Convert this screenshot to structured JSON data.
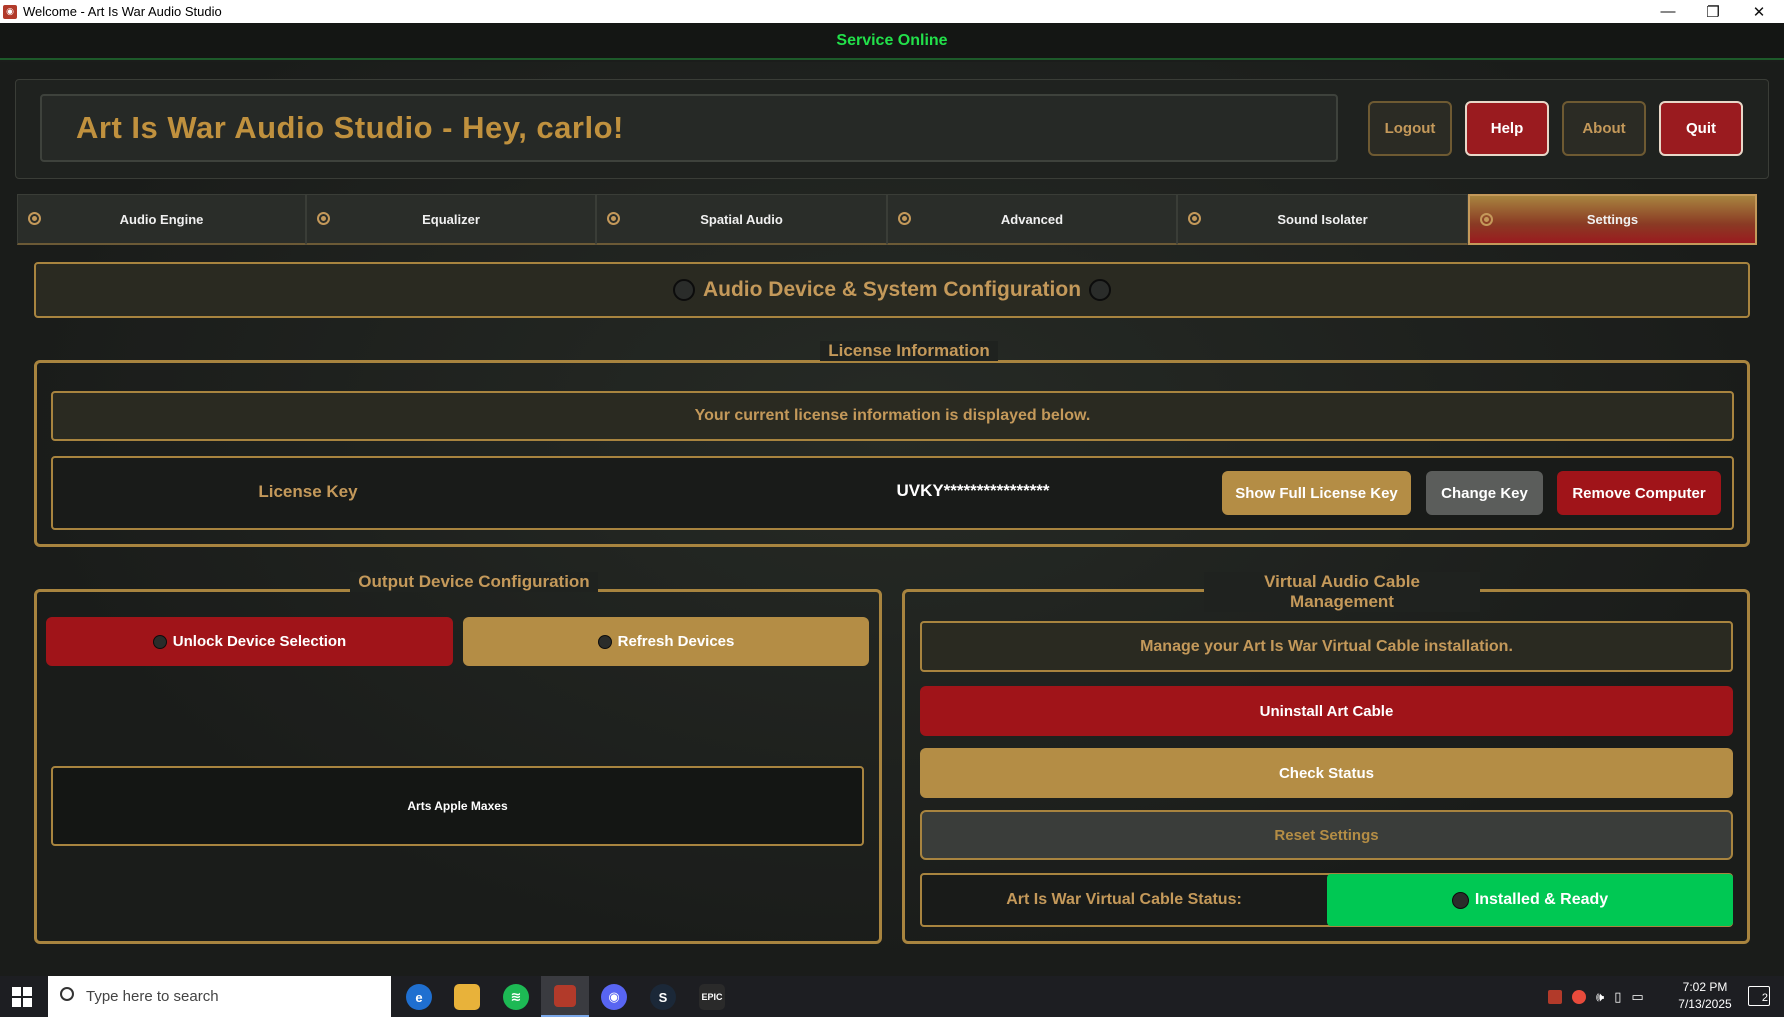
{
  "window": {
    "title": "Welcome - Art Is War Audio Studio",
    "minimize_glyph": "—",
    "restore_glyph": "❐",
    "close_glyph": "✕"
  },
  "service_status": "Service Online",
  "header": {
    "title": "Art Is War Audio Studio - Hey, carlo!",
    "buttons": {
      "logout": "Logout",
      "help": "Help",
      "about": "About",
      "quit": "Quit"
    }
  },
  "tabs": [
    {
      "label": "Audio Engine",
      "active": false
    },
    {
      "label": "Equalizer",
      "active": false
    },
    {
      "label": "Spatial Audio",
      "active": false
    },
    {
      "label": "Advanced",
      "active": false
    },
    {
      "label": "Sound Isolater",
      "active": false
    },
    {
      "label": "Settings",
      "active": true
    }
  ],
  "section_title": "Audio Device & System Configuration",
  "license": {
    "group_title": "License Information",
    "info_text": "Your current license information is displayed below.",
    "key_label": "License Key",
    "key_value": "UVKY****************",
    "show_full_button": "Show Full License Key",
    "change_key_button": "Change Key",
    "remove_computer_button": "Remove Computer"
  },
  "output_device": {
    "group_title": "Output Device Configuration",
    "unlock_button": "Unlock Device Selection",
    "refresh_button": "Refresh Devices",
    "selected_device": "Arts Apple Maxes"
  },
  "virtual_cable": {
    "group_title": "Virtual Audio Cable Management",
    "info_text": "Manage your Art Is War Virtual Cable installation.",
    "uninstall_button": "Uninstall Art Cable",
    "check_status_button": "Check Status",
    "reset_settings_button": "Reset Settings",
    "status_label": "Art Is War Virtual Cable Status:",
    "status_value": "Installed & Ready"
  },
  "taskbar": {
    "search_placeholder": "Type here to search",
    "time": "7:02 PM",
    "date": "7/13/2025",
    "notification_count": "2"
  },
  "colors": {
    "accent_gold": "#c4995a",
    "danger_red": "#a01419",
    "success_green": "#00c853",
    "service_green": "#22e04a"
  }
}
